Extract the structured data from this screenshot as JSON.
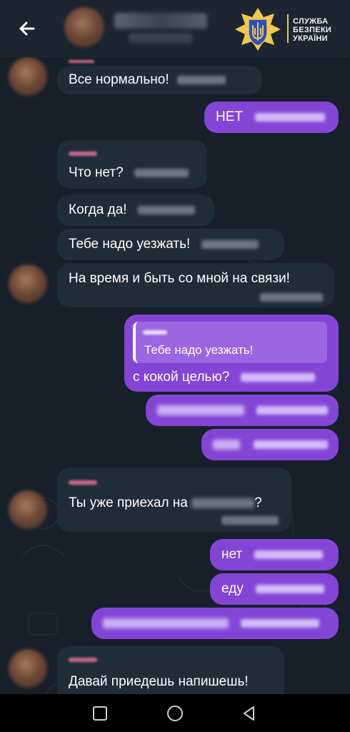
{
  "header": {
    "back_icon": "arrow-left-icon",
    "logo_icon": "sbu-trident-shield-icon",
    "org_line1": "СЛУЖБА",
    "org_line2": "БЕЗПЕКИ",
    "org_line3": "УКРАЇНИ",
    "colors": {
      "logo_blue": "#2b4fbf",
      "logo_gold": "#f2c94c"
    }
  },
  "chat": {
    "messages": [
      {
        "dir": "in",
        "text": "Все нормально!"
      },
      {
        "dir": "out",
        "text": "НЕТ"
      },
      {
        "dir": "in",
        "text": "Что нет?"
      },
      {
        "dir": "in",
        "text": "Когда да!"
      },
      {
        "dir": "in",
        "text": "Тебе надо уезжать!"
      },
      {
        "dir": "in",
        "text": "На время и быть со мной на связи!"
      },
      {
        "dir": "out",
        "reply_quote": "Тебе надо уезжать!",
        "text": "с кокой целью?"
      },
      {
        "dir": "in",
        "text_before": "Ты уже приехал на",
        "text_after": "?"
      },
      {
        "dir": "out",
        "text": "нет"
      },
      {
        "dir": "out",
        "text": "еду"
      },
      {
        "dir": "in",
        "text": "Давай приедешь напишешь!"
      }
    ]
  },
  "colors": {
    "background": "#172029",
    "incoming_bubble": "#1f2d38",
    "outgoing_bubble": "#8345d6"
  },
  "navbar": {
    "recent_icon": "square-icon",
    "home_icon": "circle-icon",
    "back_icon": "triangle-back-icon"
  }
}
